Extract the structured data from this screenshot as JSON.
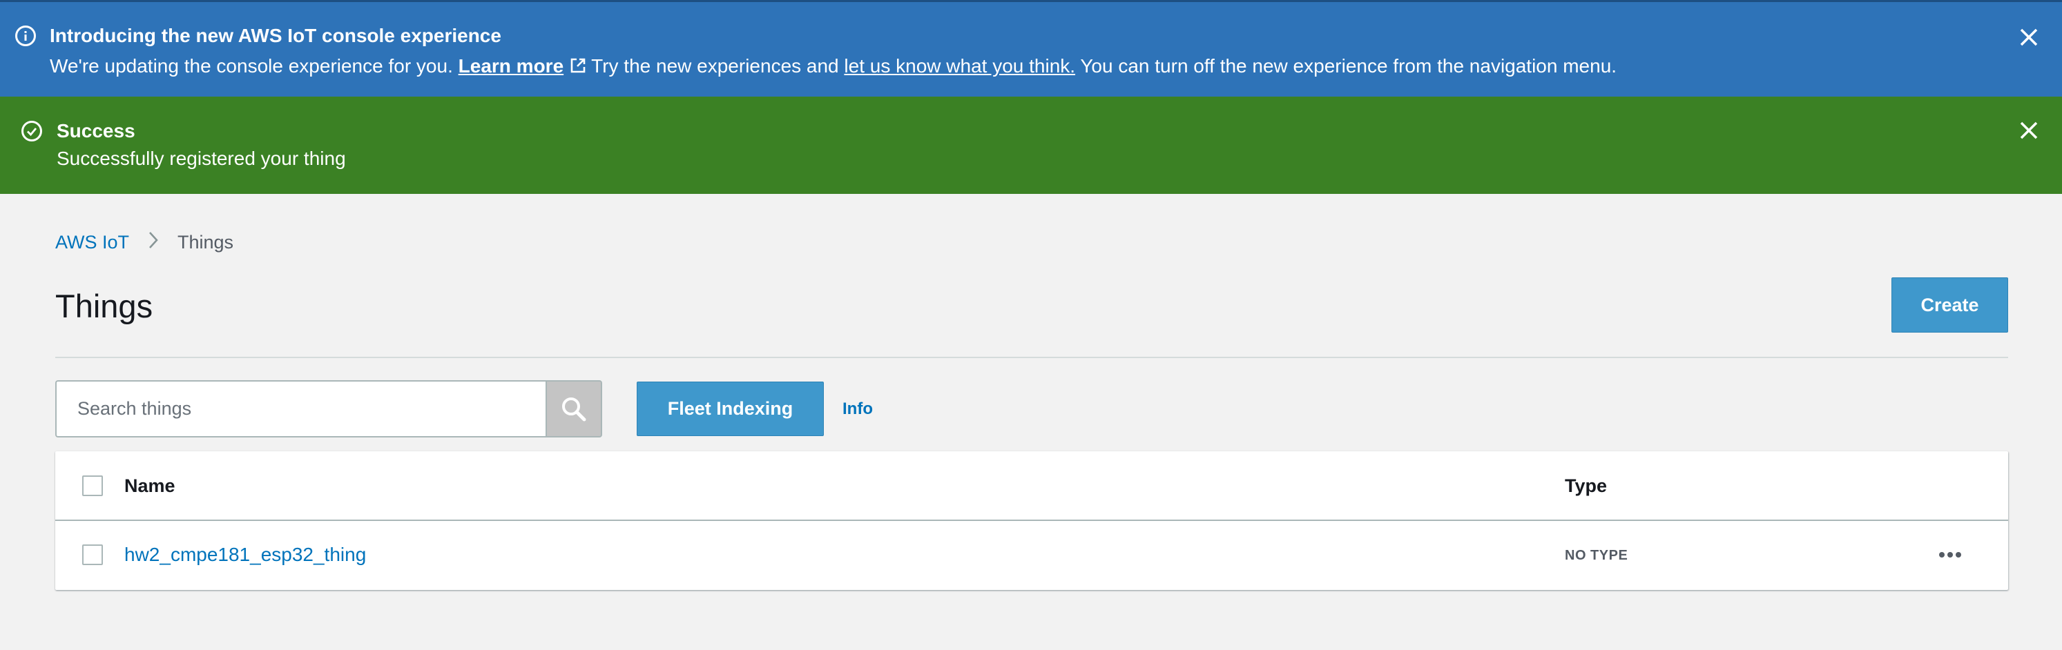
{
  "info_banner": {
    "title": "Introducing the new AWS IoT console experience",
    "text_before": "We're updating the console experience for you. ",
    "learn_more_label": "Learn more",
    "text_middle": "Try the new experiences and ",
    "feedback_link_label": "let us know what you think.",
    "text_after": " You can turn off the new experience from the navigation menu.",
    "icon": "info-icon",
    "color": "#2e73b8"
  },
  "success_banner": {
    "title": "Success",
    "message": "Successfully registered your thing",
    "icon": "check-circle-icon",
    "color": "#3b8124"
  },
  "breadcrumb": {
    "root": "AWS IoT",
    "current": "Things"
  },
  "page": {
    "title": "Things",
    "create_label": "Create"
  },
  "toolbar": {
    "search_placeholder": "Search things",
    "fleet_indexing_label": "Fleet Indexing",
    "info_label": "Info"
  },
  "table": {
    "columns": [
      "Name",
      "Type"
    ],
    "rows": [
      {
        "name": "hw2_cmpe181_esp32_thing",
        "type": "NO TYPE"
      }
    ]
  },
  "colors": {
    "accent_button": "#3f98cc",
    "link": "#0073bb",
    "background": "#f2f2f2"
  }
}
